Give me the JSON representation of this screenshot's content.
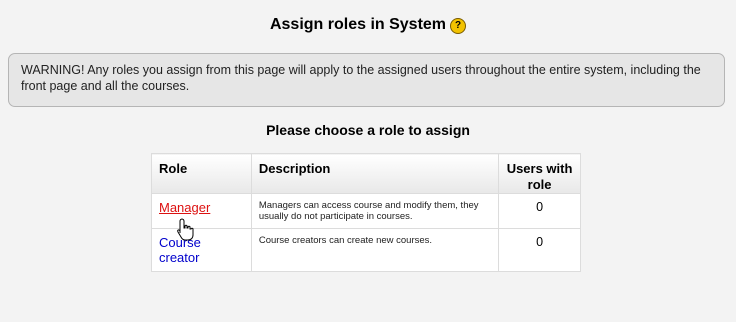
{
  "page": {
    "heading": "Assign roles in System",
    "help_icon": "?",
    "warning": "WARNING! Any roles you assign from this page will apply to the assigned users throughout the entire system, including the front page and all the courses.",
    "subheading": "Please choose a role to assign"
  },
  "table": {
    "headers": {
      "role": "Role",
      "description": "Description",
      "users": "Users with role"
    },
    "rows": [
      {
        "role": "Manager",
        "description": "Managers can access course and modify them, they usually do not participate in courses.",
        "users": "0"
      },
      {
        "role": "Course creator",
        "description": "Course creators can create new courses.",
        "users": "0"
      }
    ]
  },
  "colors": {
    "link": "#0000cc",
    "link_hover": "#dd1111",
    "warning_bg": "#e6e6e6"
  },
  "cursor": {
    "icon": "hand-pointer-icon"
  }
}
